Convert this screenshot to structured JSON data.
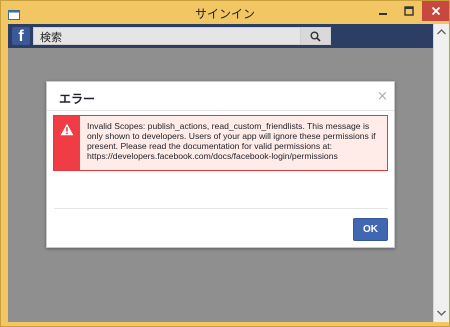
{
  "window": {
    "title": "サインイン"
  },
  "facebook_bar": {
    "logo": "f",
    "search_placeholder": "検索",
    "search_icon": "search-icon"
  },
  "dialog": {
    "title": "エラー",
    "close_glyph": "×",
    "error_icon": "warning-icon",
    "error_message": "Invalid Scopes: publish_actions, read_custom_friendlists. This message is only shown to developers. Users of your app will ignore these permissions if present. Please read the documentation for valid permissions at: https://developers.facebook.com/docs/facebook-login/permissions",
    "ok_label": "OK"
  },
  "colors": {
    "window_frame": "#f2c763",
    "close_button": "#c7483d",
    "facebook_bar": "#2c3e63",
    "overlay": "#8f8f8f",
    "error_red": "#f03d45",
    "ok_button": "#4267b2"
  }
}
